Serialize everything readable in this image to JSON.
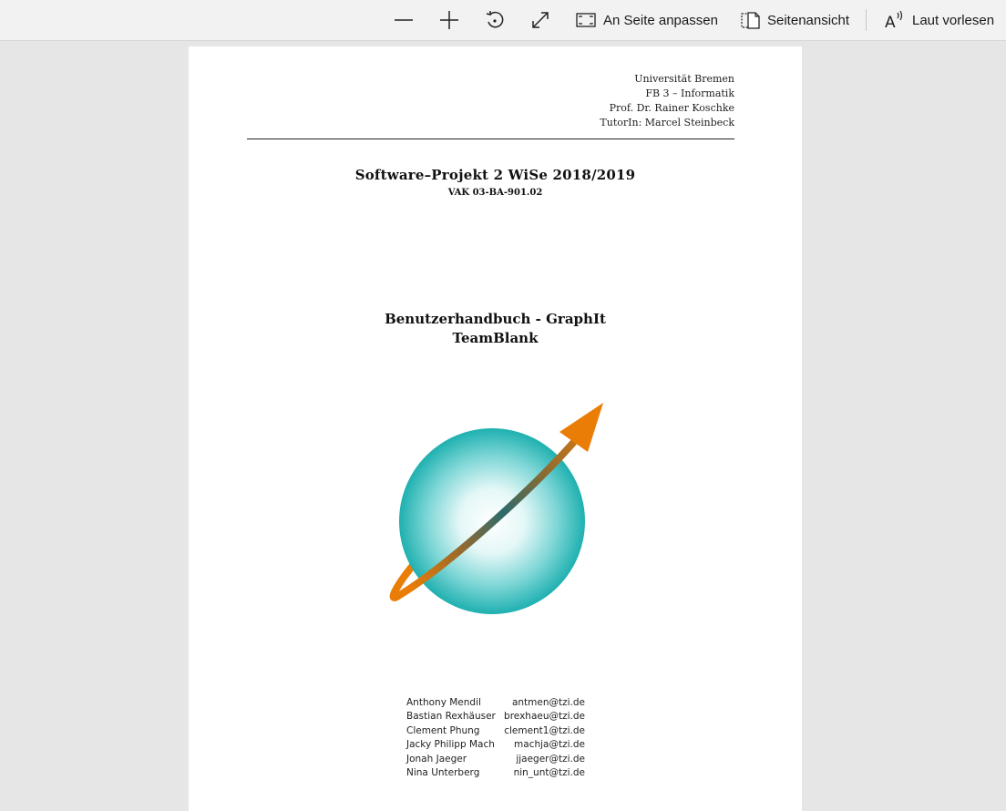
{
  "toolbar": {
    "zoom_out_icon": "minus-icon",
    "zoom_in_icon": "plus-icon",
    "rotate_icon": "rotate-icon",
    "fullscreen_icon": "expand-icon",
    "fit_page_label": "An Seite anpassen",
    "page_view_label": "Seitenansicht",
    "read_aloud_label": "Laut vorlesen"
  },
  "document": {
    "university": [
      "Universität Bremen",
      "FB 3 – Informatik",
      "Prof. Dr. Rainer Koschke",
      "TutorIn: Marcel Steinbeck"
    ],
    "course_title": "Software–Projekt 2 WiSe 2018/2019",
    "course_code": "VAK 03-BA-901.02",
    "title": "Benutzerhandbuch - GraphIt",
    "team": "TeamBlank",
    "authors": [
      {
        "name": "Anthony Mendil",
        "email": "antmen@tzi.de"
      },
      {
        "name": "Bastian Rexhäuser",
        "email": "brexhaeu@tzi.de"
      },
      {
        "name": "Clement Phung",
        "email": "clement1@tzi.de"
      },
      {
        "name": "Jacky Philipp Mach",
        "email": "machja@tzi.de"
      },
      {
        "name": "Jonah Jaeger",
        "email": "jjaeger@tzi.de"
      },
      {
        "name": "Nina Unterberg",
        "email": "nin_unt@tzi.de"
      }
    ]
  },
  "colors": {
    "globe": "#1fb0b0",
    "arrow": "#ea7d06",
    "toolbar_bg": "#f2f2f2",
    "viewer_bg": "#e6e6e6"
  }
}
